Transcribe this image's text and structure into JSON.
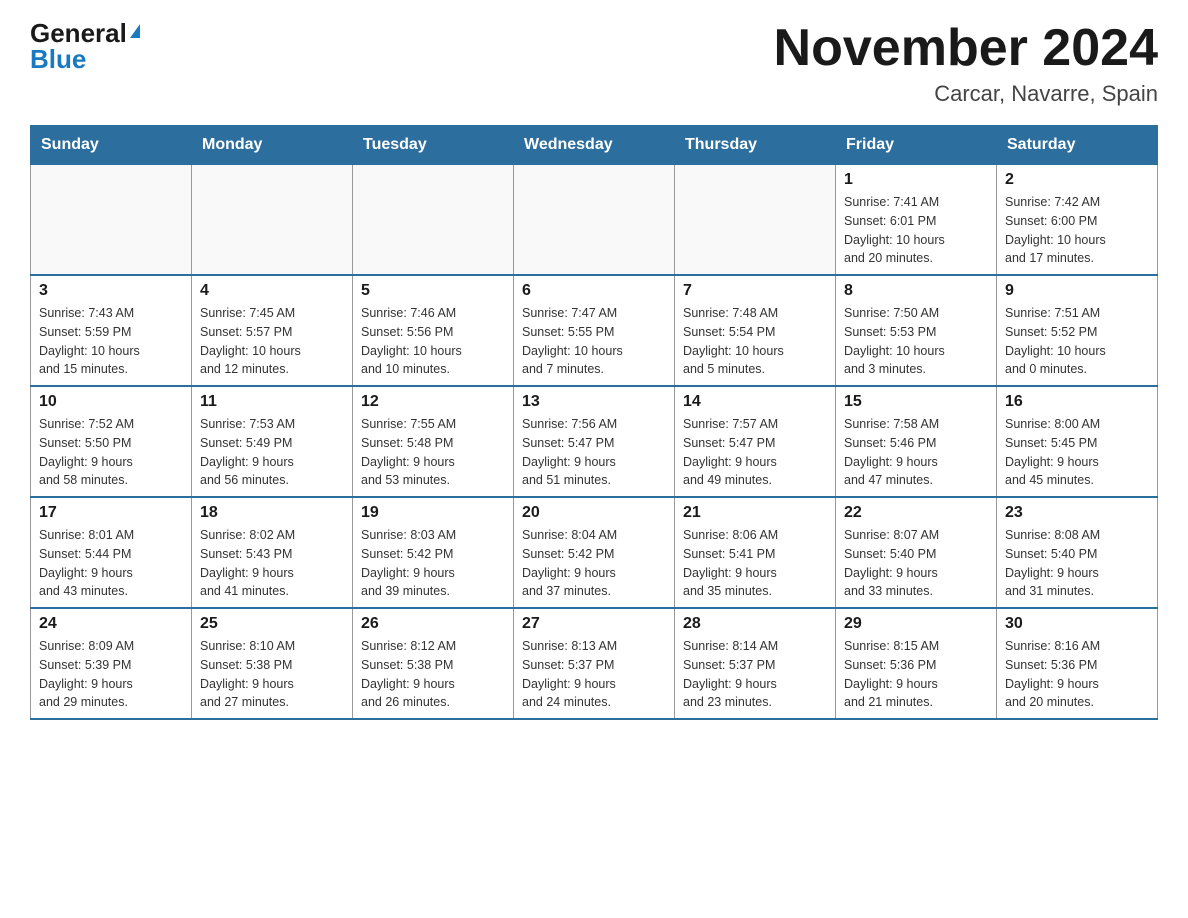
{
  "header": {
    "logo_general": "General",
    "logo_blue": "Blue",
    "title": "November 2024",
    "subtitle": "Carcar, Navarre, Spain"
  },
  "calendar": {
    "days_of_week": [
      "Sunday",
      "Monday",
      "Tuesday",
      "Wednesday",
      "Thursday",
      "Friday",
      "Saturday"
    ],
    "weeks": [
      [
        {
          "day": "",
          "info": ""
        },
        {
          "day": "",
          "info": ""
        },
        {
          "day": "",
          "info": ""
        },
        {
          "day": "",
          "info": ""
        },
        {
          "day": "",
          "info": ""
        },
        {
          "day": "1",
          "info": "Sunrise: 7:41 AM\nSunset: 6:01 PM\nDaylight: 10 hours\nand 20 minutes."
        },
        {
          "day": "2",
          "info": "Sunrise: 7:42 AM\nSunset: 6:00 PM\nDaylight: 10 hours\nand 17 minutes."
        }
      ],
      [
        {
          "day": "3",
          "info": "Sunrise: 7:43 AM\nSunset: 5:59 PM\nDaylight: 10 hours\nand 15 minutes."
        },
        {
          "day": "4",
          "info": "Sunrise: 7:45 AM\nSunset: 5:57 PM\nDaylight: 10 hours\nand 12 minutes."
        },
        {
          "day": "5",
          "info": "Sunrise: 7:46 AM\nSunset: 5:56 PM\nDaylight: 10 hours\nand 10 minutes."
        },
        {
          "day": "6",
          "info": "Sunrise: 7:47 AM\nSunset: 5:55 PM\nDaylight: 10 hours\nand 7 minutes."
        },
        {
          "day": "7",
          "info": "Sunrise: 7:48 AM\nSunset: 5:54 PM\nDaylight: 10 hours\nand 5 minutes."
        },
        {
          "day": "8",
          "info": "Sunrise: 7:50 AM\nSunset: 5:53 PM\nDaylight: 10 hours\nand 3 minutes."
        },
        {
          "day": "9",
          "info": "Sunrise: 7:51 AM\nSunset: 5:52 PM\nDaylight: 10 hours\nand 0 minutes."
        }
      ],
      [
        {
          "day": "10",
          "info": "Sunrise: 7:52 AM\nSunset: 5:50 PM\nDaylight: 9 hours\nand 58 minutes."
        },
        {
          "day": "11",
          "info": "Sunrise: 7:53 AM\nSunset: 5:49 PM\nDaylight: 9 hours\nand 56 minutes."
        },
        {
          "day": "12",
          "info": "Sunrise: 7:55 AM\nSunset: 5:48 PM\nDaylight: 9 hours\nand 53 minutes."
        },
        {
          "day": "13",
          "info": "Sunrise: 7:56 AM\nSunset: 5:47 PM\nDaylight: 9 hours\nand 51 minutes."
        },
        {
          "day": "14",
          "info": "Sunrise: 7:57 AM\nSunset: 5:47 PM\nDaylight: 9 hours\nand 49 minutes."
        },
        {
          "day": "15",
          "info": "Sunrise: 7:58 AM\nSunset: 5:46 PM\nDaylight: 9 hours\nand 47 minutes."
        },
        {
          "day": "16",
          "info": "Sunrise: 8:00 AM\nSunset: 5:45 PM\nDaylight: 9 hours\nand 45 minutes."
        }
      ],
      [
        {
          "day": "17",
          "info": "Sunrise: 8:01 AM\nSunset: 5:44 PM\nDaylight: 9 hours\nand 43 minutes."
        },
        {
          "day": "18",
          "info": "Sunrise: 8:02 AM\nSunset: 5:43 PM\nDaylight: 9 hours\nand 41 minutes."
        },
        {
          "day": "19",
          "info": "Sunrise: 8:03 AM\nSunset: 5:42 PM\nDaylight: 9 hours\nand 39 minutes."
        },
        {
          "day": "20",
          "info": "Sunrise: 8:04 AM\nSunset: 5:42 PM\nDaylight: 9 hours\nand 37 minutes."
        },
        {
          "day": "21",
          "info": "Sunrise: 8:06 AM\nSunset: 5:41 PM\nDaylight: 9 hours\nand 35 minutes."
        },
        {
          "day": "22",
          "info": "Sunrise: 8:07 AM\nSunset: 5:40 PM\nDaylight: 9 hours\nand 33 minutes."
        },
        {
          "day": "23",
          "info": "Sunrise: 8:08 AM\nSunset: 5:40 PM\nDaylight: 9 hours\nand 31 minutes."
        }
      ],
      [
        {
          "day": "24",
          "info": "Sunrise: 8:09 AM\nSunset: 5:39 PM\nDaylight: 9 hours\nand 29 minutes."
        },
        {
          "day": "25",
          "info": "Sunrise: 8:10 AM\nSunset: 5:38 PM\nDaylight: 9 hours\nand 27 minutes."
        },
        {
          "day": "26",
          "info": "Sunrise: 8:12 AM\nSunset: 5:38 PM\nDaylight: 9 hours\nand 26 minutes."
        },
        {
          "day": "27",
          "info": "Sunrise: 8:13 AM\nSunset: 5:37 PM\nDaylight: 9 hours\nand 24 minutes."
        },
        {
          "day": "28",
          "info": "Sunrise: 8:14 AM\nSunset: 5:37 PM\nDaylight: 9 hours\nand 23 minutes."
        },
        {
          "day": "29",
          "info": "Sunrise: 8:15 AM\nSunset: 5:36 PM\nDaylight: 9 hours\nand 21 minutes."
        },
        {
          "day": "30",
          "info": "Sunrise: 8:16 AM\nSunset: 5:36 PM\nDaylight: 9 hours\nand 20 minutes."
        }
      ]
    ]
  }
}
